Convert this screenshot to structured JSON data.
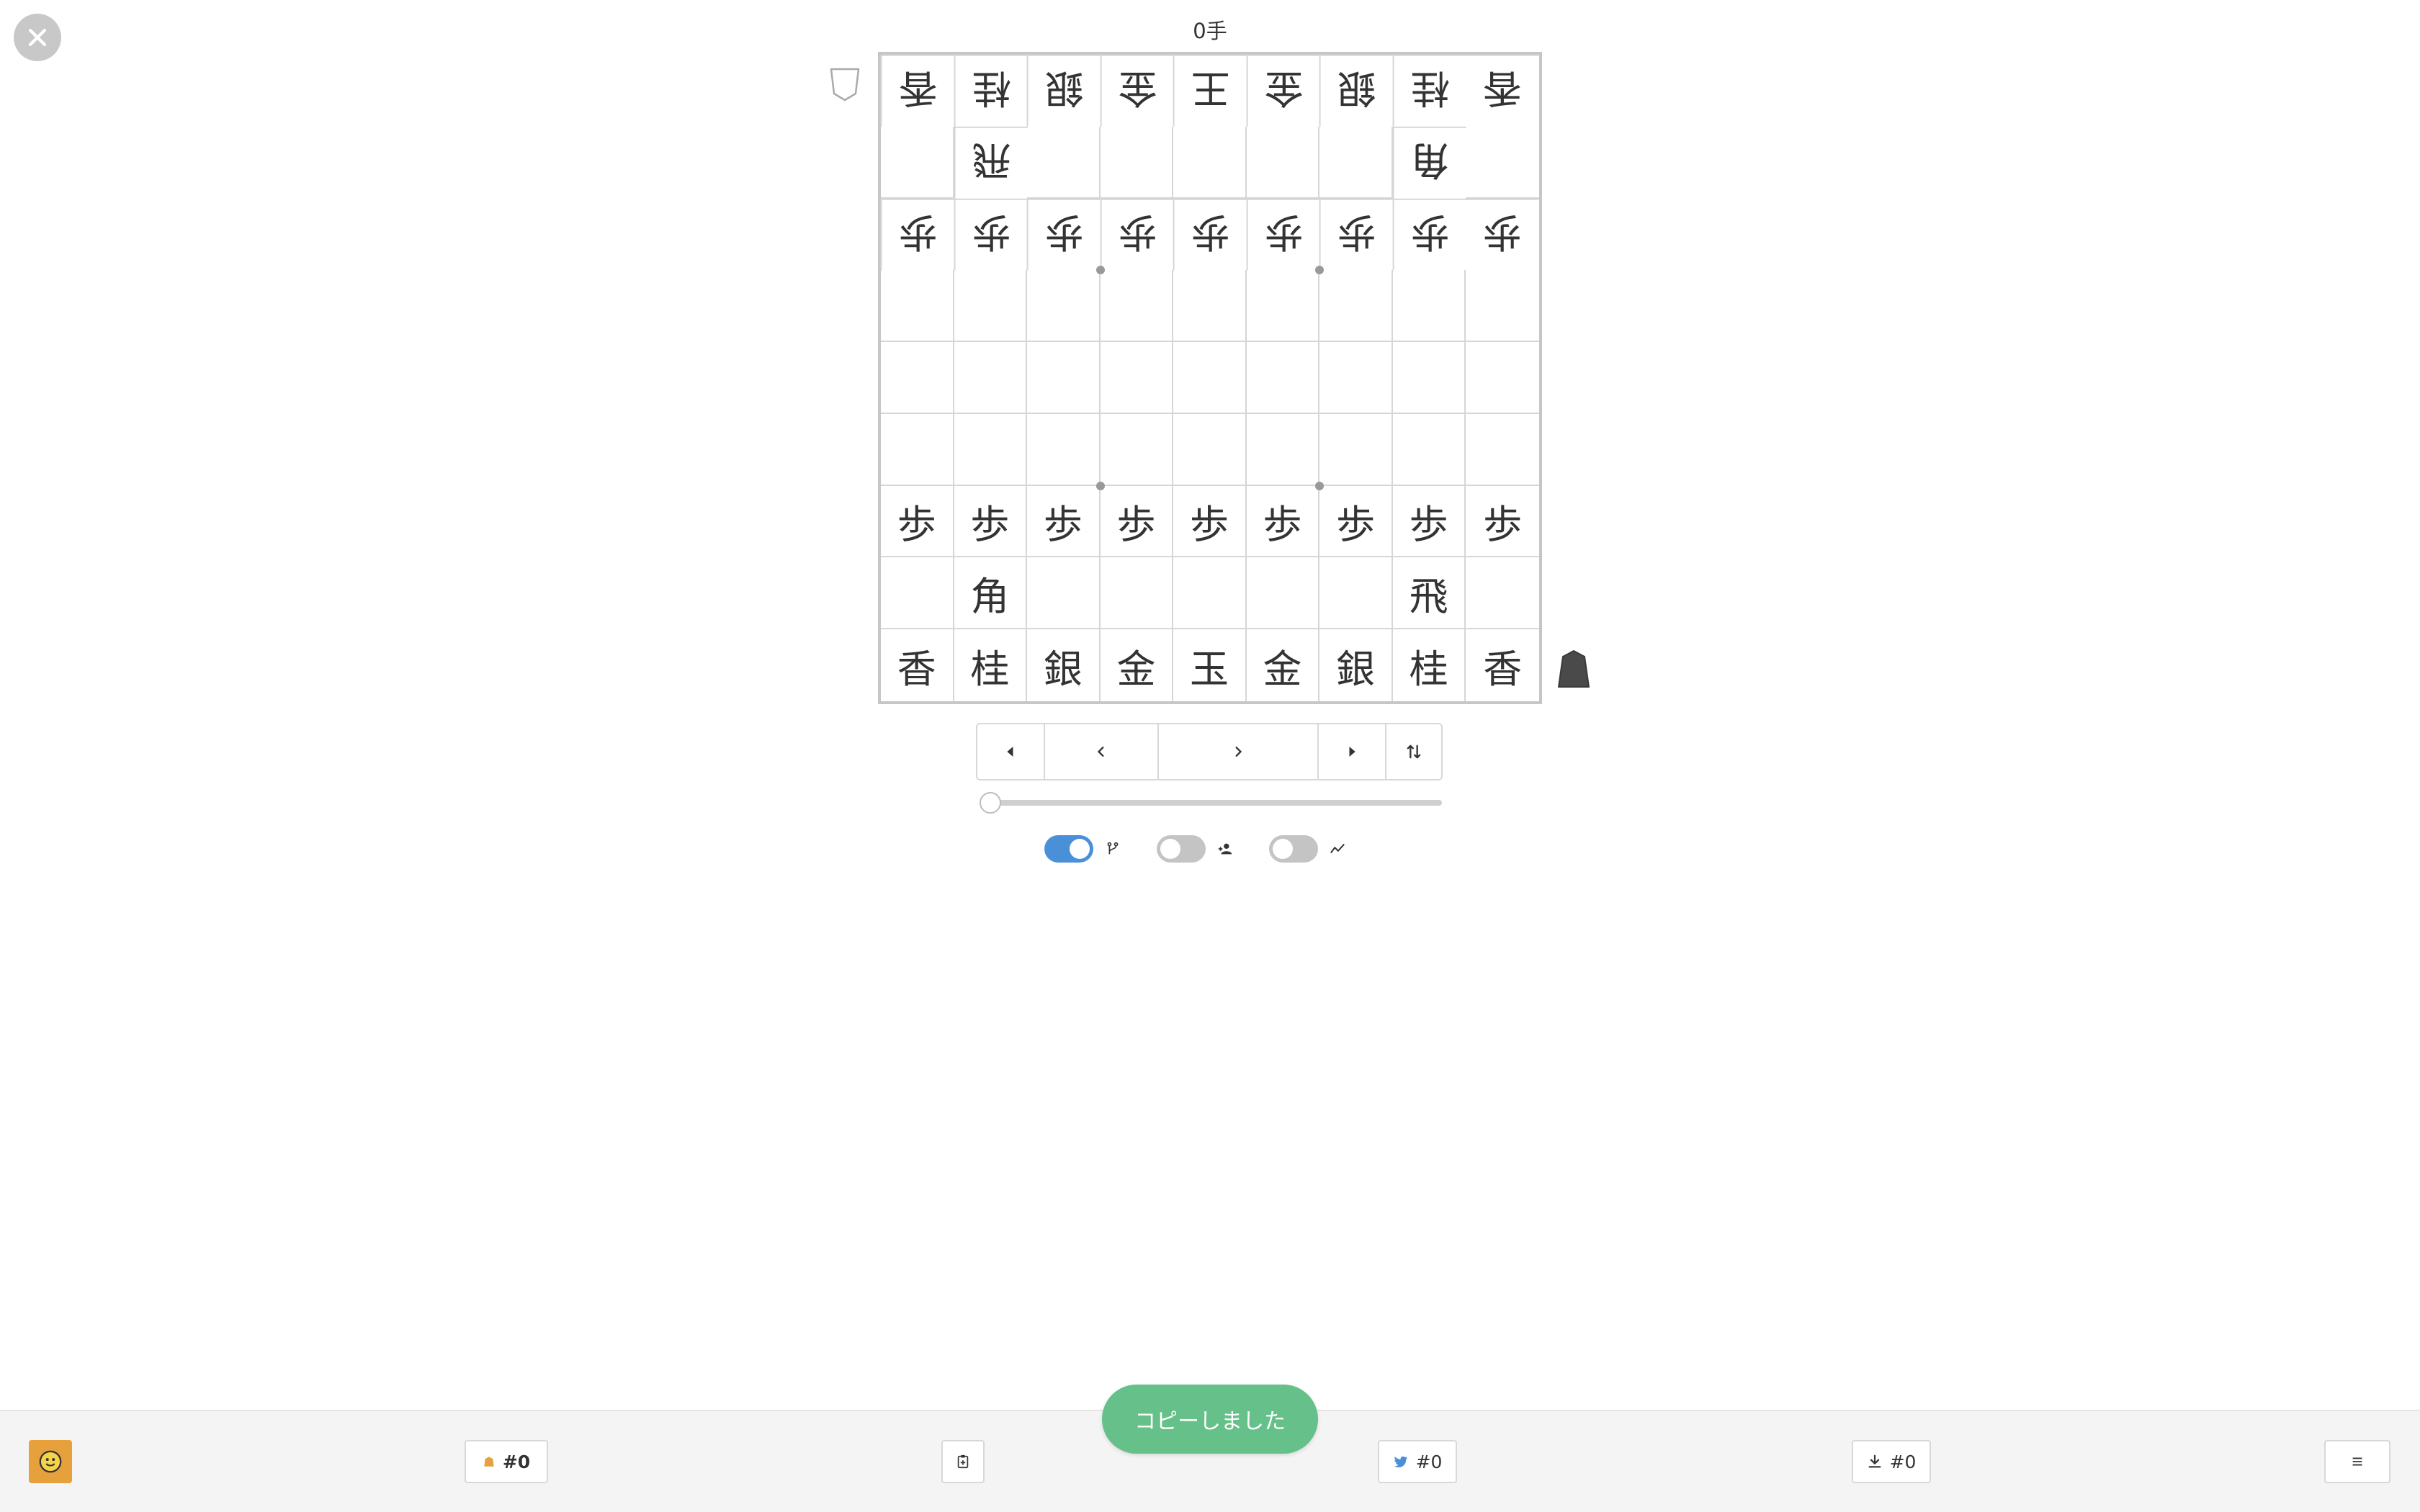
{
  "header": {
    "move_count": "0手"
  },
  "board": {
    "rows": [
      [
        {
          "p": "香",
          "g": true
        },
        {
          "p": "桂",
          "g": true
        },
        {
          "p": "銀",
          "g": true
        },
        {
          "p": "金",
          "g": true
        },
        {
          "p": "王",
          "g": true
        },
        {
          "p": "金",
          "g": true
        },
        {
          "p": "銀",
          "g": true
        },
        {
          "p": "桂",
          "g": true
        },
        {
          "p": "香",
          "g": true
        }
      ],
      [
        {
          "p": "",
          "g": false
        },
        {
          "p": "飛",
          "g": true
        },
        {
          "p": "",
          "g": false
        },
        {
          "p": "",
          "g": false
        },
        {
          "p": "",
          "g": false
        },
        {
          "p": "",
          "g": false
        },
        {
          "p": "",
          "g": false
        },
        {
          "p": "角",
          "g": true
        },
        {
          "p": "",
          "g": false
        }
      ],
      [
        {
          "p": "歩",
          "g": true
        },
        {
          "p": "歩",
          "g": true
        },
        {
          "p": "歩",
          "g": true
        },
        {
          "p": "歩",
          "g": true
        },
        {
          "p": "歩",
          "g": true
        },
        {
          "p": "歩",
          "g": true
        },
        {
          "p": "歩",
          "g": true
        },
        {
          "p": "歩",
          "g": true
        },
        {
          "p": "歩",
          "g": true
        }
      ],
      [
        {
          "p": "",
          "g": false
        },
        {
          "p": "",
          "g": false
        },
        {
          "p": "",
          "g": false
        },
        {
          "p": "",
          "g": false
        },
        {
          "p": "",
          "g": false
        },
        {
          "p": "",
          "g": false
        },
        {
          "p": "",
          "g": false
        },
        {
          "p": "",
          "g": false
        },
        {
          "p": "",
          "g": false
        }
      ],
      [
        {
          "p": "",
          "g": false
        },
        {
          "p": "",
          "g": false
        },
        {
          "p": "",
          "g": false
        },
        {
          "p": "",
          "g": false
        },
        {
          "p": "",
          "g": false
        },
        {
          "p": "",
          "g": false
        },
        {
          "p": "",
          "g": false
        },
        {
          "p": "",
          "g": false
        },
        {
          "p": "",
          "g": false
        }
      ],
      [
        {
          "p": "",
          "g": false
        },
        {
          "p": "",
          "g": false
        },
        {
          "p": "",
          "g": false
        },
        {
          "p": "",
          "g": false
        },
        {
          "p": "",
          "g": false
        },
        {
          "p": "",
          "g": false
        },
        {
          "p": "",
          "g": false
        },
        {
          "p": "",
          "g": false
        },
        {
          "p": "",
          "g": false
        }
      ],
      [
        {
          "p": "歩",
          "g": false
        },
        {
          "p": "歩",
          "g": false
        },
        {
          "p": "歩",
          "g": false
        },
        {
          "p": "歩",
          "g": false
        },
        {
          "p": "歩",
          "g": false
        },
        {
          "p": "歩",
          "g": false
        },
        {
          "p": "歩",
          "g": false
        },
        {
          "p": "歩",
          "g": false
        },
        {
          "p": "歩",
          "g": false
        }
      ],
      [
        {
          "p": "",
          "g": false
        },
        {
          "p": "角",
          "g": false
        },
        {
          "p": "",
          "g": false
        },
        {
          "p": "",
          "g": false
        },
        {
          "p": "",
          "g": false
        },
        {
          "p": "",
          "g": false
        },
        {
          "p": "",
          "g": false
        },
        {
          "p": "飛",
          "g": false
        },
        {
          "p": "",
          "g": false
        }
      ],
      [
        {
          "p": "香",
          "g": false
        },
        {
          "p": "桂",
          "g": false
        },
        {
          "p": "銀",
          "g": false
        },
        {
          "p": "金",
          "g": false
        },
        {
          "p": "玉",
          "g": false
        },
        {
          "p": "金",
          "g": false
        },
        {
          "p": "銀",
          "g": false
        },
        {
          "p": "桂",
          "g": false
        },
        {
          "p": "香",
          "g": false
        }
      ]
    ]
  },
  "navigation": {
    "first_icon": "skip-first-icon",
    "prev_icon": "chevron-left-icon",
    "next_icon": "chevron-right-icon",
    "last_icon": "skip-last-icon",
    "flip_icon": "flip-board-icon"
  },
  "slider": {
    "position": 0
  },
  "toggles": [
    {
      "icon": "branch-icon",
      "on": true
    },
    {
      "icon": "user-add-icon",
      "on": false
    },
    {
      "icon": "chart-line-icon",
      "on": false
    }
  ],
  "toast": {
    "text": "コピーしました"
  },
  "footer": {
    "avatar_icon": "smiley-icon",
    "piece_button_label": "#0",
    "clipboard_icon": "clipboard-icon",
    "twitter_button_label": "#0",
    "download_button_label": "#0",
    "menu_icon": "menu-icon"
  },
  "colors": {
    "toggle_on": "#4a90d9",
    "toast": "#66c08a",
    "avatar": "#e6a03c",
    "twitter": "#4a90d9",
    "piece_icon": "#e6a03c"
  }
}
